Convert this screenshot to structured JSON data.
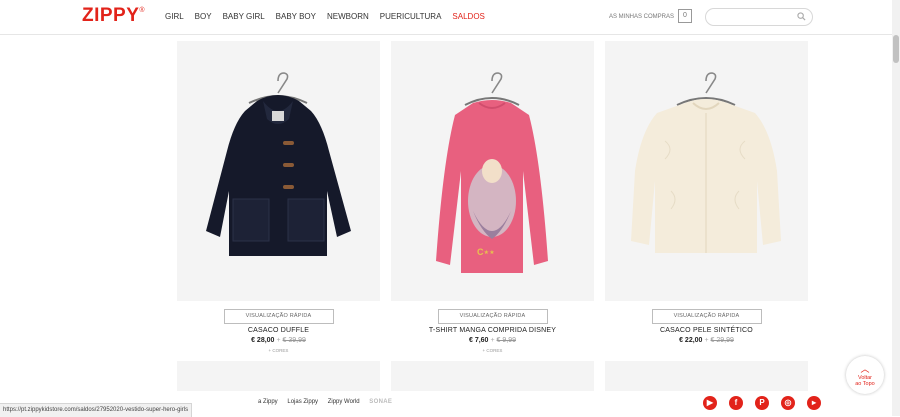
{
  "header": {
    "logo": "ZIPPY",
    "logo_mark": "®",
    "nav": [
      "GIRL",
      "BOY",
      "BABY GIRL",
      "BABY BOY",
      "NEWBORN",
      "PUERICULTURA",
      "SALDOS"
    ],
    "cart_label": "AS MINHAS COMPRAS",
    "cart_count": "0",
    "search": {
      "value": "",
      "placeholder": ""
    }
  },
  "products": [
    {
      "quick_view": "VISUALIZAÇÃO RÁPIDA",
      "name": "CASACO DUFFLE",
      "price_now": "€ 28,00",
      "price_old": "€ 39,99",
      "colors": "+ CORES"
    },
    {
      "quick_view": "VISUALIZAÇÃO RÁPIDA",
      "name": "T-SHIRT MANGA COMPRIDA DISNEY",
      "price_now": "€ 7,60",
      "price_old": "€ 9,99",
      "colors": "+ CORES"
    },
    {
      "quick_view": "VISUALIZAÇÃO RÁPIDA",
      "name": "CASACO PELE SINTÉTICO",
      "price_now": "€ 22,00",
      "price_old": "€ 29,99",
      "colors": ""
    }
  ],
  "back_to_top": {
    "line1": "Voltar",
    "line2": "ao Topo"
  },
  "status_url": "https://pt.zippykidstore.com/saldos/27952020-vestido-super-hero-girls",
  "footer": {
    "links": [
      "a Zippy",
      "Lojas Zippy",
      "Zippy World"
    ],
    "brand": "SONAE"
  },
  "social": [
    "youtube-icon",
    "facebook-icon",
    "pinterest-icon",
    "instagram-icon",
    "youtube-play-icon"
  ],
  "colors": {
    "brand": "#e2231a"
  }
}
